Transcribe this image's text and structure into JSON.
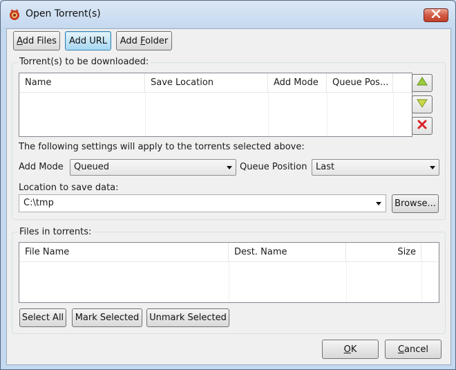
{
  "window": {
    "title": "Open Torrent(s)"
  },
  "toolbar": {
    "add_files": {
      "pre": "",
      "key": "A",
      "post": "dd Files"
    },
    "add_url": "Add URL",
    "add_folder": {
      "pre": "Add ",
      "key": "F",
      "post": "older"
    }
  },
  "torrents_group": {
    "label": "Torrent(s) to be downloaded:",
    "columns": [
      "Name",
      "Save Location",
      "Add Mode",
      "Queue Pos..."
    ]
  },
  "settings": {
    "note": "The following settings will apply to the torrents selected above:",
    "add_mode_label": "Add Mode",
    "add_mode_value": "Queued",
    "queue_position_label": "Queue Position",
    "queue_position_value": "Last",
    "location_label": "Location to save data:",
    "location_value": "C:\\tmp",
    "browse_label": "Browse..."
  },
  "files_group": {
    "label": "Files in torrents:",
    "columns": [
      "File Name",
      "Dest. Name",
      "Size"
    ],
    "select_all": "Select All",
    "mark_selected": "Mark Selected",
    "unmark_selected": "Unmark Selected"
  },
  "footer": {
    "ok": {
      "key": "O",
      "post": "K"
    },
    "cancel": {
      "key": "C",
      "post": "ancel"
    }
  },
  "icons": {
    "app": "deluge-icon",
    "move_up": "arrow-up-icon",
    "move_down": "arrow-down-icon",
    "remove": "remove-x-icon",
    "close": "close-icon"
  },
  "colors": {
    "arrow_green": "#7fb42a",
    "remove_red": "#d9242b",
    "focus_blue": "#3c7fb1"
  }
}
